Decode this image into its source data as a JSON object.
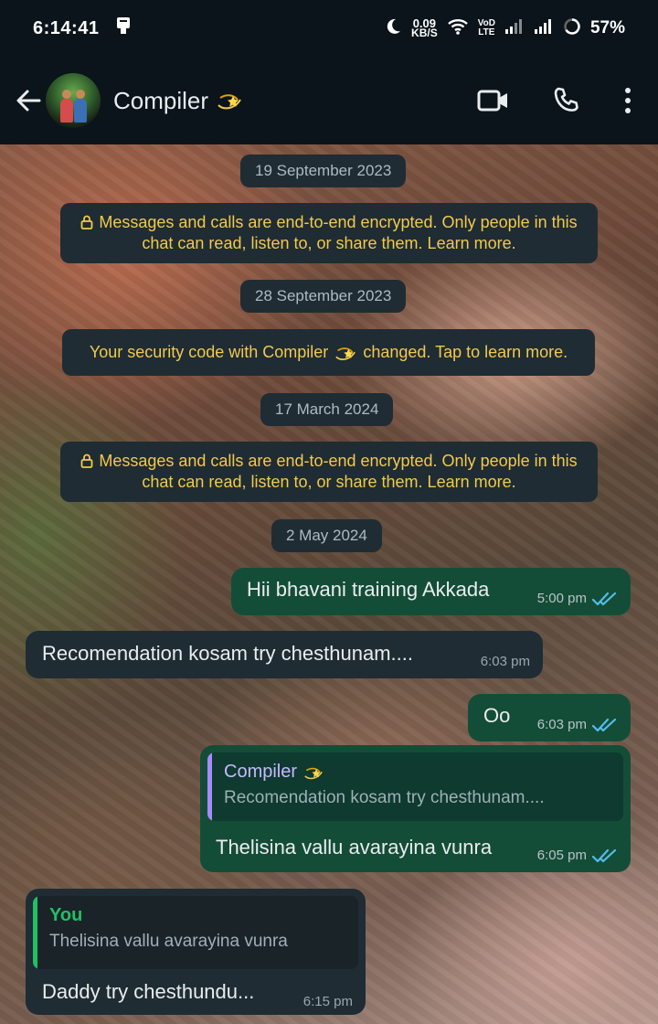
{
  "status_bar": {
    "time": "6:14:41",
    "net_speed": "0.09",
    "net_unit": "KB/S",
    "vo_label": "VoD",
    "lte_label": "LTE",
    "battery": "57%"
  },
  "header": {
    "contact_name": "Compiler",
    "avatar": "group-photo"
  },
  "chat": {
    "date_1": "19 September 2023",
    "notice_1": "Messages and calls are end-to-end encrypted. Only people in this chat can read, listen to, or share them. Learn more.",
    "date_2": "28 September 2023",
    "notice_2_before": "Your security code with Compiler",
    "notice_2_after": "changed. Tap to learn more.",
    "date_3": "17 March 2024",
    "notice_3": "Messages and calls are end-to-end encrypted. Only people in this chat can read, listen to, or share them. Learn more.",
    "date_4": "2 May 2024",
    "messages": [
      {
        "direction": "out",
        "text": "Hii bhavani training Akkada",
        "time": "5:00 pm",
        "status": "read"
      },
      {
        "direction": "in",
        "text": "Recomendation kosam try chesthunam....",
        "time": "6:03 pm"
      },
      {
        "direction": "out",
        "text": "Oo",
        "time": "6:03 pm",
        "status": "read"
      },
      {
        "direction": "out",
        "quote_author": "Compiler",
        "quote_text": "Recomendation kosam try chesthunam....",
        "text": "Thelisina vallu avarayina vunra",
        "time": "6:05 pm",
        "status": "read"
      },
      {
        "direction": "in",
        "quote_author": "You",
        "quote_text": "Thelisina vallu avarayina vunra",
        "text": "Daddy try chesthundu...",
        "time": "6:15 pm"
      }
    ]
  },
  "colors": {
    "outgoing_bubble": "#144d37",
    "incoming_bubble": "#1f2c34",
    "notice_text": "#f2c94c",
    "read_ticks": "#53bdeb"
  }
}
